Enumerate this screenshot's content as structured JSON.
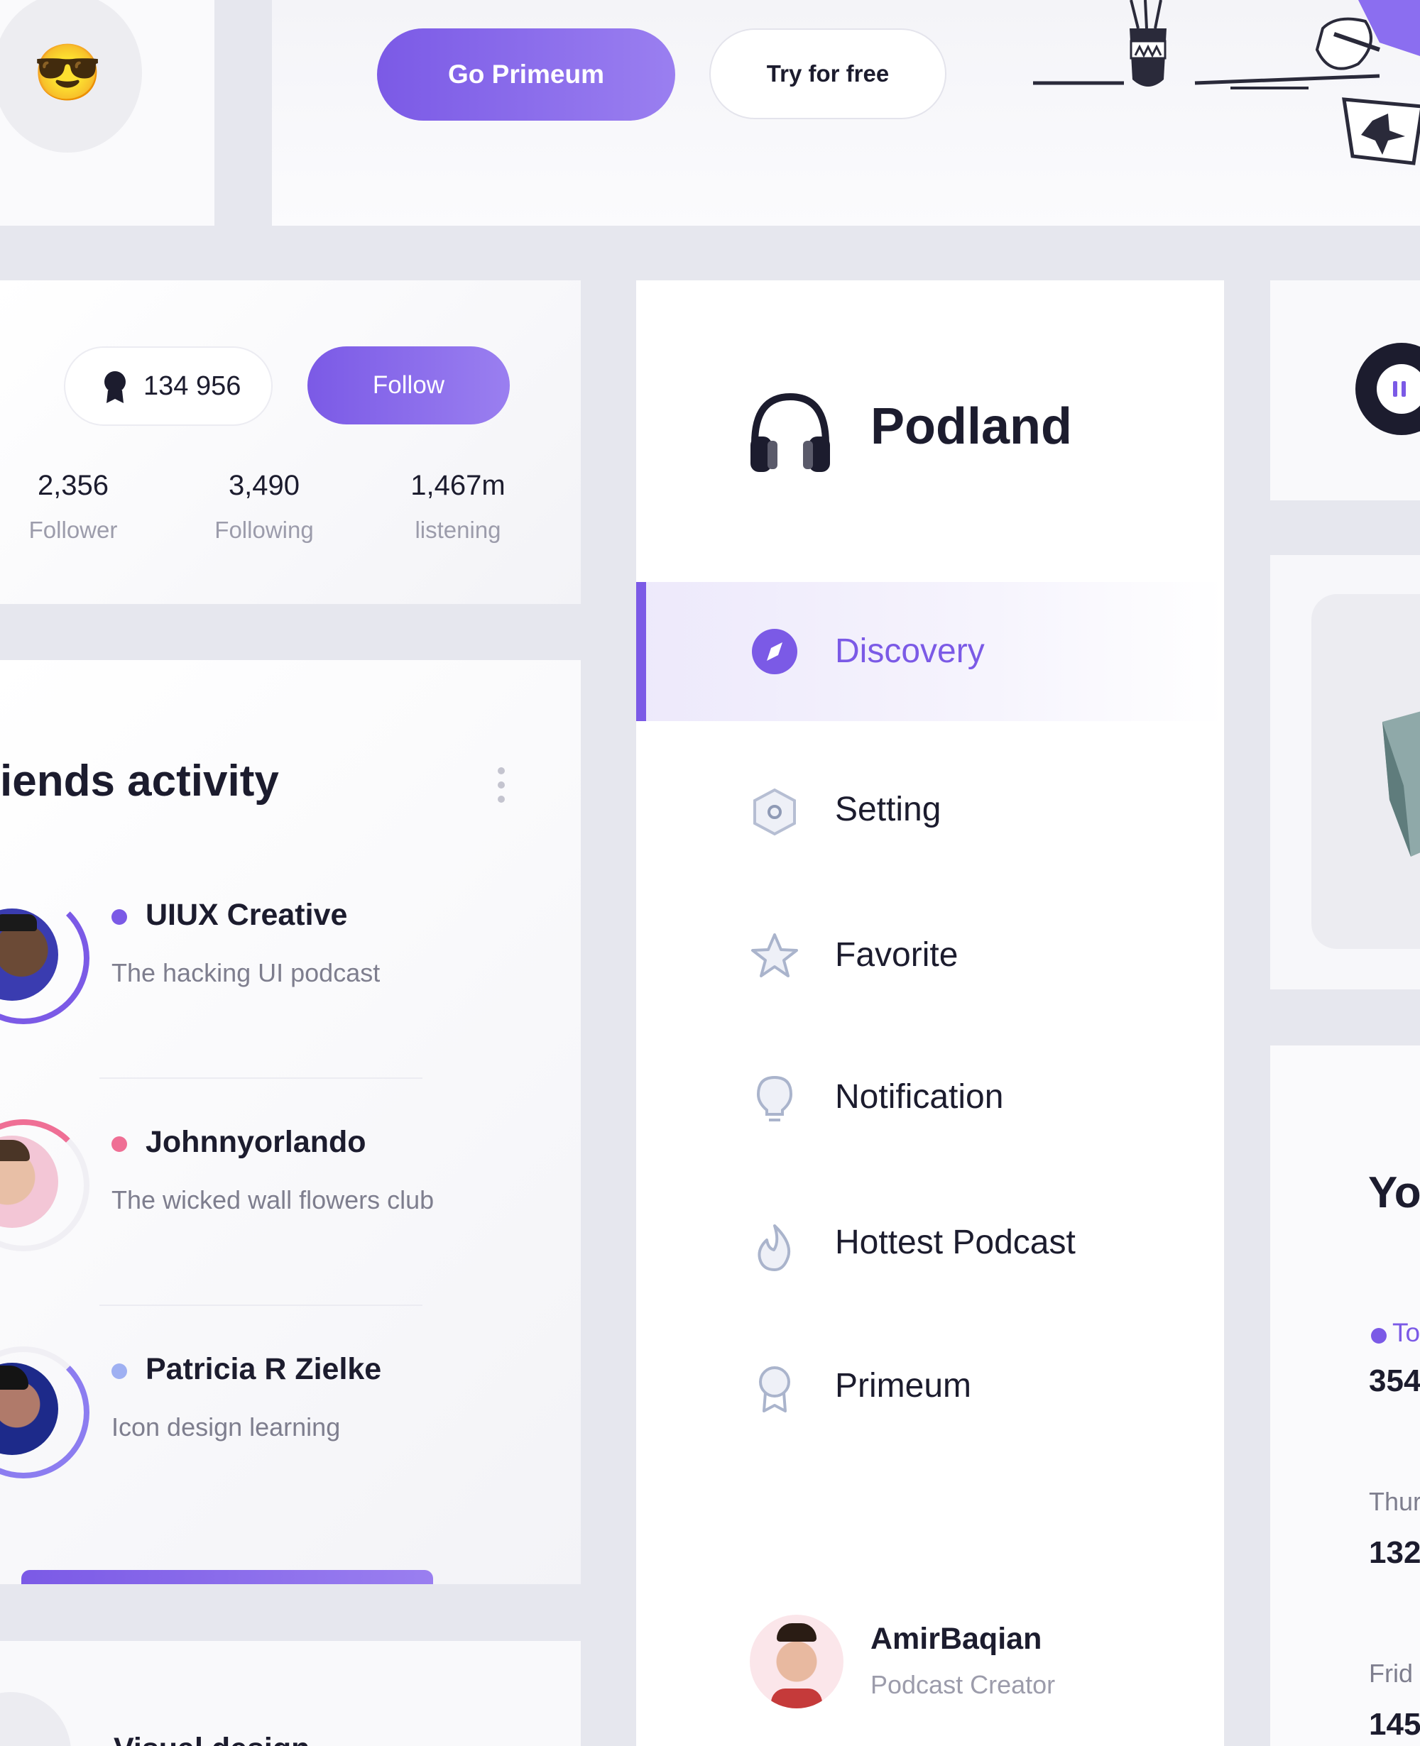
{
  "top": {
    "emoji": "😎",
    "go_premium_label": "Go Primeum",
    "try_free_label": "Try for free"
  },
  "profile": {
    "badge_count": "134 956",
    "follow_label": "Follow",
    "stats": [
      {
        "value": "2,356",
        "label": "Follower"
      },
      {
        "value": "3,490",
        "label": "Following"
      },
      {
        "value": "1,467m",
        "label": "listening"
      }
    ]
  },
  "friends": {
    "title": "iends activity",
    "items": [
      {
        "name": "UIUX Creative",
        "subtitle": "The hacking UI podcast",
        "dot_color": "#7b5ae6"
      },
      {
        "name": "Johnnyorlando",
        "subtitle": "The wicked wall flowers club",
        "dot_color": "#ef6f95"
      },
      {
        "name": "Patricia R Zielke",
        "subtitle": "Icon design learning",
        "dot_color": "#9fb0f2"
      }
    ],
    "bottom_title": "Visual design"
  },
  "sidebar": {
    "brand": "Podland",
    "items": [
      {
        "label": "Discovery",
        "icon": "compass-icon",
        "active": true
      },
      {
        "label": "Setting",
        "icon": "hexagon-settings-icon",
        "active": false
      },
      {
        "label": "Favorite",
        "icon": "star-icon",
        "active": false
      },
      {
        "label": "Notification",
        "icon": "lightbulb-icon",
        "active": false
      },
      {
        "label": "Hottest Podcast",
        "icon": "flame-icon",
        "active": false
      },
      {
        "label": "Primeum",
        "icon": "badge-icon",
        "active": false
      }
    ],
    "user": {
      "name": "AmirBaqian",
      "role": "Podcast Creator"
    }
  },
  "right": {
    "heading_partial": "Yo",
    "entries": [
      {
        "label": "To",
        "value": "354"
      },
      {
        "label": "Thur",
        "value": "132"
      },
      {
        "label": "Frid",
        "value": "145"
      }
    ]
  },
  "colors": {
    "accent": "#7b5ae6",
    "background": "#e6e7ee",
    "pink": "#ef6f95"
  }
}
